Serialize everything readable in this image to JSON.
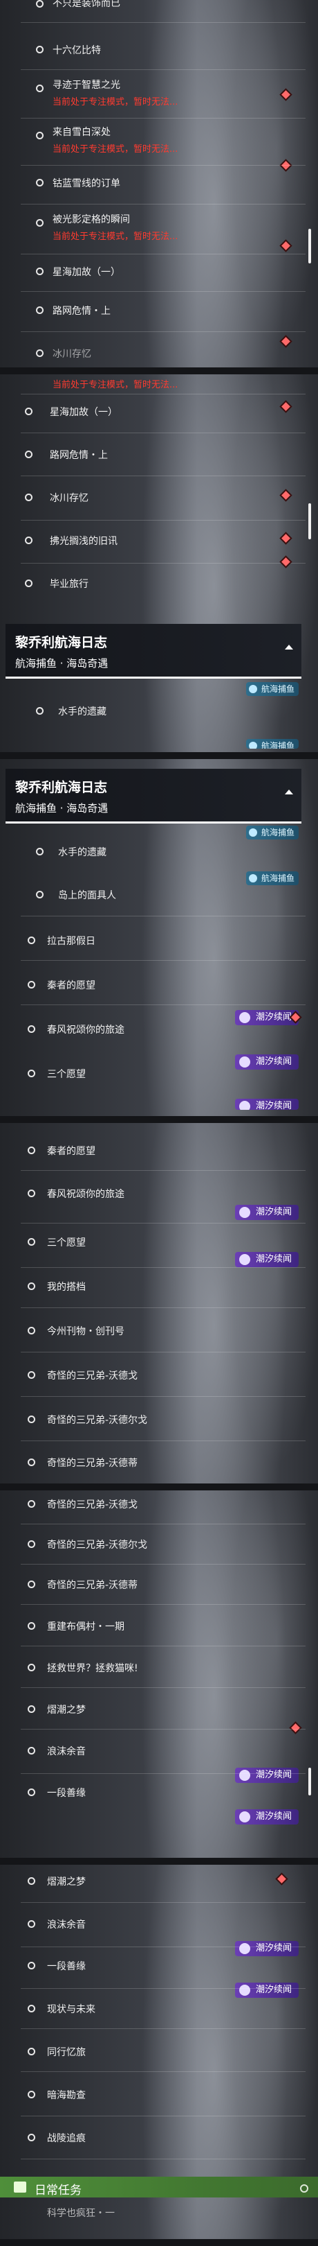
{
  "status": {
    "focus_mode": "当前处于专注模式，暂时无法..."
  },
  "badges": {
    "tide": "潮汐续闻",
    "sail": "航海捕鱼"
  },
  "section": {
    "title": "黎乔利航海日志",
    "subtitle": "航海捕鱼 · 海岛奇遇"
  },
  "daily": {
    "title": "日常任务"
  },
  "panel1": {
    "items": [
      {
        "title": "不只是装饰而已"
      },
      {
        "title": "十六亿比特"
      },
      {
        "title": "寻迹于智慧之光"
      },
      {
        "title": "来自雪白深处"
      },
      {
        "title": "钴蓝雪线的订单"
      },
      {
        "title": "被光影定格的瞬间"
      },
      {
        "title": "星海加故（一）"
      },
      {
        "title": "路网危情・上"
      },
      {
        "title": "冰川存忆"
      }
    ]
  },
  "panel2": {
    "items": [
      {
        "title": "星海加故（一）"
      },
      {
        "title": "路网危情・上"
      },
      {
        "title": "冰川存忆"
      },
      {
        "title": "拂光搁浅的旧讯"
      },
      {
        "title": "毕业旅行"
      },
      {
        "title": "水手的遗藏"
      }
    ]
  },
  "panel3": {
    "items": [
      {
        "title": "水手的遗藏"
      },
      {
        "title": "岛上的面具人"
      },
      {
        "title": "拉古那假日"
      },
      {
        "title": "秦者的愿望"
      },
      {
        "title": "春风祝颂你的旅途"
      },
      {
        "title": "三个愿望"
      }
    ]
  },
  "panel4": {
    "items": [
      {
        "title": "秦者的愿望"
      },
      {
        "title": "春风祝颂你的旅途"
      },
      {
        "title": "三个愿望"
      },
      {
        "title": "我的搭档"
      },
      {
        "title": "今州刊物・创刊号"
      },
      {
        "title": "奇怪的三兄弟-沃德戈"
      },
      {
        "title": "奇怪的三兄弟-沃德尔戈"
      },
      {
        "title": "奇怪的三兄弟-沃德蒂"
      }
    ]
  },
  "panel5": {
    "items": [
      {
        "title": "奇怪的三兄弟-沃德戈"
      },
      {
        "title": "奇怪的三兄弟-沃德尔戈"
      },
      {
        "title": "奇怪的三兄弟-沃德蒂"
      },
      {
        "title": "重建布偶村・一期"
      },
      {
        "title": "拯救世界？拯救猫咪!"
      },
      {
        "title": "熠潮之梦"
      },
      {
        "title": "浪沫余音"
      },
      {
        "title": "一段善缘"
      }
    ]
  },
  "panel6": {
    "items": [
      {
        "title": "熠潮之梦"
      },
      {
        "title": "浪沫余音"
      },
      {
        "title": "一段善缘"
      },
      {
        "title": "现状与未来"
      },
      {
        "title": "同行忆旅"
      },
      {
        "title": "暗海勘查"
      },
      {
        "title": "战陵追痕"
      },
      {
        "title": "科学也疯狂・一"
      }
    ]
  }
}
